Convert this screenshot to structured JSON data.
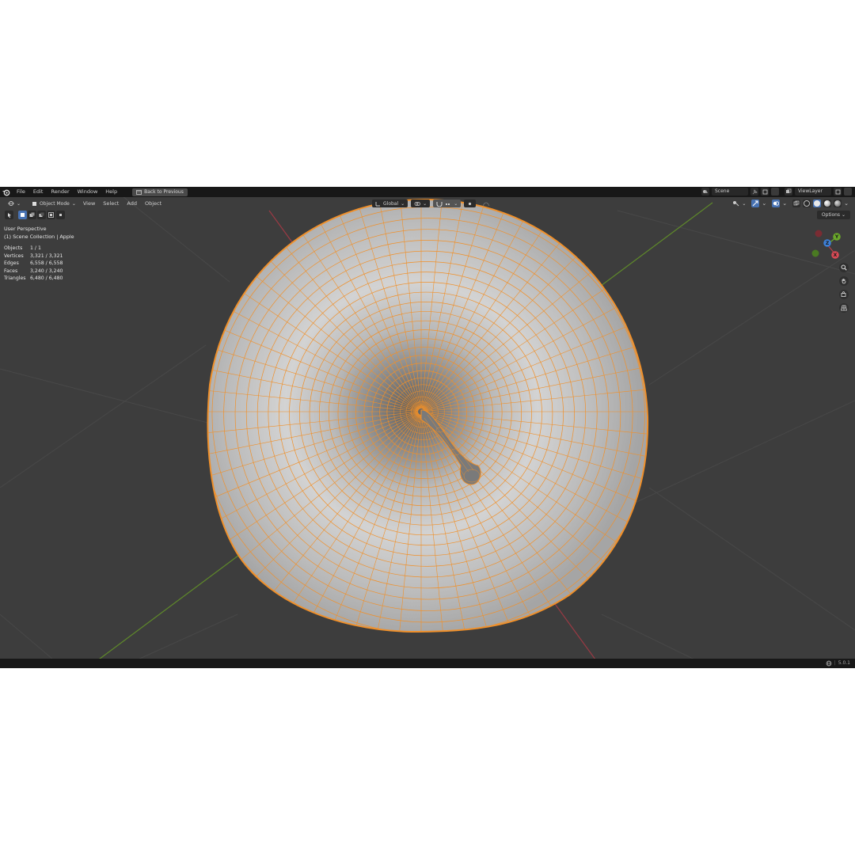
{
  "menu": {
    "items": [
      "File",
      "Edit",
      "Render",
      "Window",
      "Help"
    ],
    "back_button": "Back to Previous"
  },
  "topbar_right": {
    "scene": "Scene",
    "view_layer": "ViewLayer"
  },
  "viewport_header": {
    "mode": "Object Mode",
    "menus": [
      "View",
      "Select",
      "Add",
      "Object"
    ],
    "orientation": "Global"
  },
  "options_label": "Options",
  "overlay": {
    "perspective": "User Perspective",
    "collection": "(1) Scene Collection | Apple"
  },
  "stats": [
    {
      "label": "Objects",
      "value": "1 / 1"
    },
    {
      "label": "Vertices",
      "value": "3,321 / 3,321"
    },
    {
      "label": "Edges",
      "value": "6,558 / 6,558"
    },
    {
      "label": "Faces",
      "value": "3,240 / 3,240"
    },
    {
      "label": "Triangles",
      "value": "6,480 / 6,480"
    }
  ],
  "gizmo": {
    "x": "X",
    "y": "Y",
    "z": "Z"
  },
  "version": "5.0.1",
  "colors": {
    "selection": "#f0902a",
    "x_axis": "#b8404a",
    "y_axis": "#6aa82a",
    "z_axis": "#3d7fd6"
  }
}
